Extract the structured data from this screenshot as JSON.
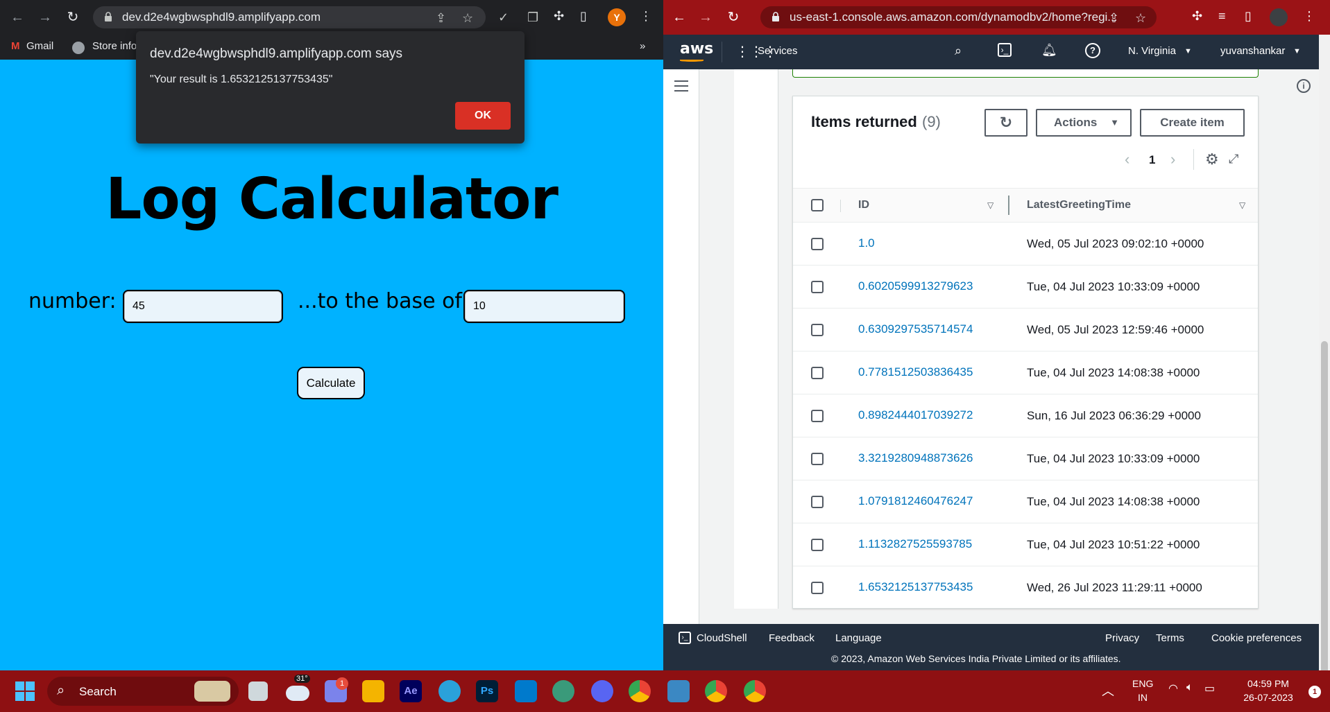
{
  "left_browser": {
    "url": "dev.d2e4wgbwsphdl9.amplifyapp.com",
    "avatar_letter": "Y",
    "bookmarks": [
      "Gmail",
      "Store info"
    ],
    "more_bookmarks": "»",
    "dialog": {
      "title": "dev.d2e4wgbwsphdl9.amplifyapp.com says",
      "message": "\"Your result is 1.6532125137753435\"",
      "ok_label": "OK"
    },
    "app": {
      "title": "Log Calculator",
      "number_label": "number:",
      "number_value": "45",
      "base_label": "...to the base of:",
      "base_value": "10",
      "calculate_label": "Calculate"
    }
  },
  "right_browser": {
    "url": "us-east-1.console.aws.amazon.com/dynamodbv2/home?regi...",
    "nav": {
      "logo": "aws",
      "services": "Services",
      "region": "N. Virginia",
      "user": "yuvanshankar"
    },
    "items": {
      "title": "Items returned",
      "count": "(9)",
      "actions_label": "Actions",
      "create_label": "Create item",
      "page": "1",
      "columns": [
        "ID",
        "LatestGreetingTime"
      ],
      "rows": [
        {
          "id": "1.0",
          "time": "Wed, 05 Jul 2023 09:02:10 +0000"
        },
        {
          "id": "0.6020599913279623",
          "time": "Tue, 04 Jul 2023 10:33:09 +0000"
        },
        {
          "id": "0.6309297535714574",
          "time": "Wed, 05 Jul 2023 12:59:46 +0000"
        },
        {
          "id": "0.7781512503836435",
          "time": "Tue, 04 Jul 2023 14:08:38 +0000"
        },
        {
          "id": "0.8982444017039272",
          "time": "Sun, 16 Jul 2023 06:36:29 +0000"
        },
        {
          "id": "3.3219280948873626",
          "time": "Tue, 04 Jul 2023 10:33:09 +0000"
        },
        {
          "id": "1.0791812460476247",
          "time": "Tue, 04 Jul 2023 14:08:38 +0000"
        },
        {
          "id": "1.1132827525593785",
          "time": "Tue, 04 Jul 2023 10:51:22 +0000"
        },
        {
          "id": "1.6532125137753435",
          "time": "Wed, 26 Jul 2023 11:29:11 +0000"
        }
      ]
    },
    "footer": {
      "cloudshell": "CloudShell",
      "feedback": "Feedback",
      "language": "Language",
      "privacy": "Privacy",
      "terms": "Terms",
      "cookies": "Cookie preferences",
      "copyright": "© 2023, Amazon Web Services India Private Limited or its affiliates."
    }
  },
  "taskbar": {
    "search_placeholder": "Search",
    "weather_temp": "31°",
    "notif_badge": "1",
    "lang_line1": "ENG",
    "lang_line2": "IN",
    "time": "04:59 PM",
    "date": "26-07-2023",
    "tray_badge": "1"
  },
  "colors": {
    "app_bg": "#00b2ff",
    "aws_nav": "#232f3e",
    "taskbar": "#8e1012",
    "link": "#0073bb",
    "ok_button": "#d93025"
  }
}
